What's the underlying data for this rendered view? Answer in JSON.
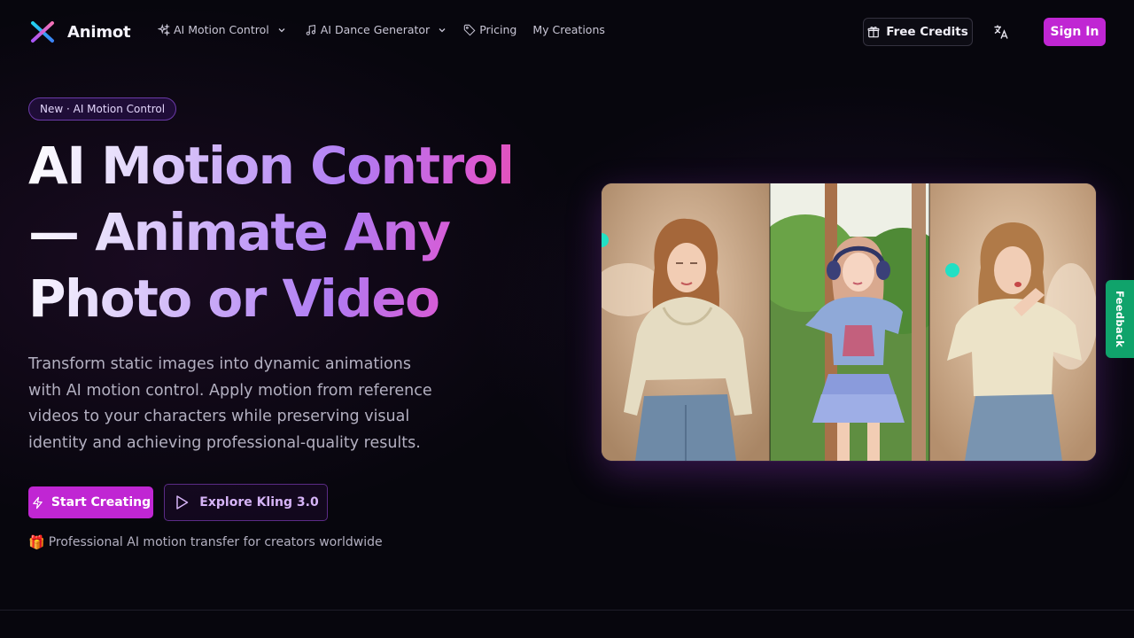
{
  "nav": {
    "brand": "Animot",
    "items": [
      {
        "label": "AI Motion Control",
        "icon": "sparkles-icon",
        "dropdown": true
      },
      {
        "label": "AI Dance Generator",
        "icon": "music-note-icon",
        "dropdown": true
      },
      {
        "label": "Pricing",
        "icon": "tag-icon",
        "dropdown": false
      },
      {
        "label": "My Creations",
        "icon": "",
        "dropdown": false
      }
    ],
    "free_credits": "Free Credits",
    "language_icon": "translate-icon",
    "sign_in": "Sign In"
  },
  "hero": {
    "badge": "New · AI Motion Control",
    "headline_line1": "AI Motion Control",
    "headline_line2": "— Animate Any",
    "headline_line3": "Photo or Video",
    "subtitle": "Transform static images into dynamic animations with AI motion control. Apply motion from reference videos to your characters while preserving visual identity and achieving professional-quality results.",
    "primary_button": "Start Creating",
    "secondary_button": "Explore Kling 3.0",
    "tagline_icon": "🎁",
    "tagline": "Professional AI motion transfer for creators worldwide"
  },
  "feedback": "Feedback",
  "colors": {
    "background": "#07060d",
    "accent": "#c026d3",
    "feedback": "#10a36b",
    "gradient_start": "#ffffff",
    "gradient_end": "#ec4899"
  }
}
